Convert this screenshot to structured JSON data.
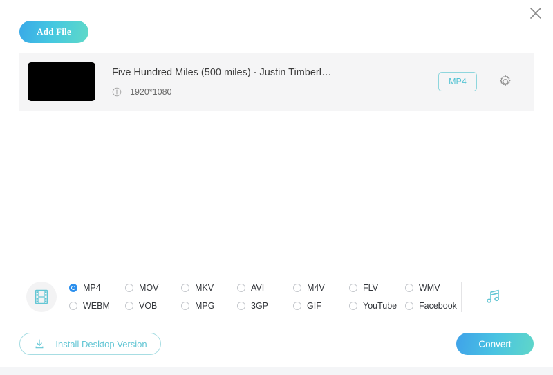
{
  "window": {
    "close_label": "×"
  },
  "toolbar": {
    "add_file_label": "Add File"
  },
  "file": {
    "title": "Five Hundred Miles (500 miles) - Justin Timberl…",
    "resolution": "1920*1080",
    "output_format_badge": "MP4",
    "info_icon": "info-icon",
    "settings_icon": "gear-icon",
    "thumbnail": "video-thumbnail"
  },
  "formats": {
    "video_icon": "film-strip-icon",
    "audio_icon": "music-note-icon",
    "selected": "MP4",
    "options": [
      "MP4",
      "MOV",
      "MKV",
      "AVI",
      "M4V",
      "FLV",
      "WMV",
      "WEBM",
      "VOB",
      "MPG",
      "3GP",
      "GIF",
      "YouTube",
      "Facebook"
    ]
  },
  "footer": {
    "install_label": "Install Desktop Version",
    "install_icon": "download-icon",
    "convert_label": "Convert"
  },
  "colors": {
    "accent_blue": "#3fa2e9",
    "accent_teal": "#5fd6c9",
    "badge_teal": "#56c4d4",
    "radio_selected": "#2b8fed",
    "row_bg": "#f5f5f6"
  }
}
